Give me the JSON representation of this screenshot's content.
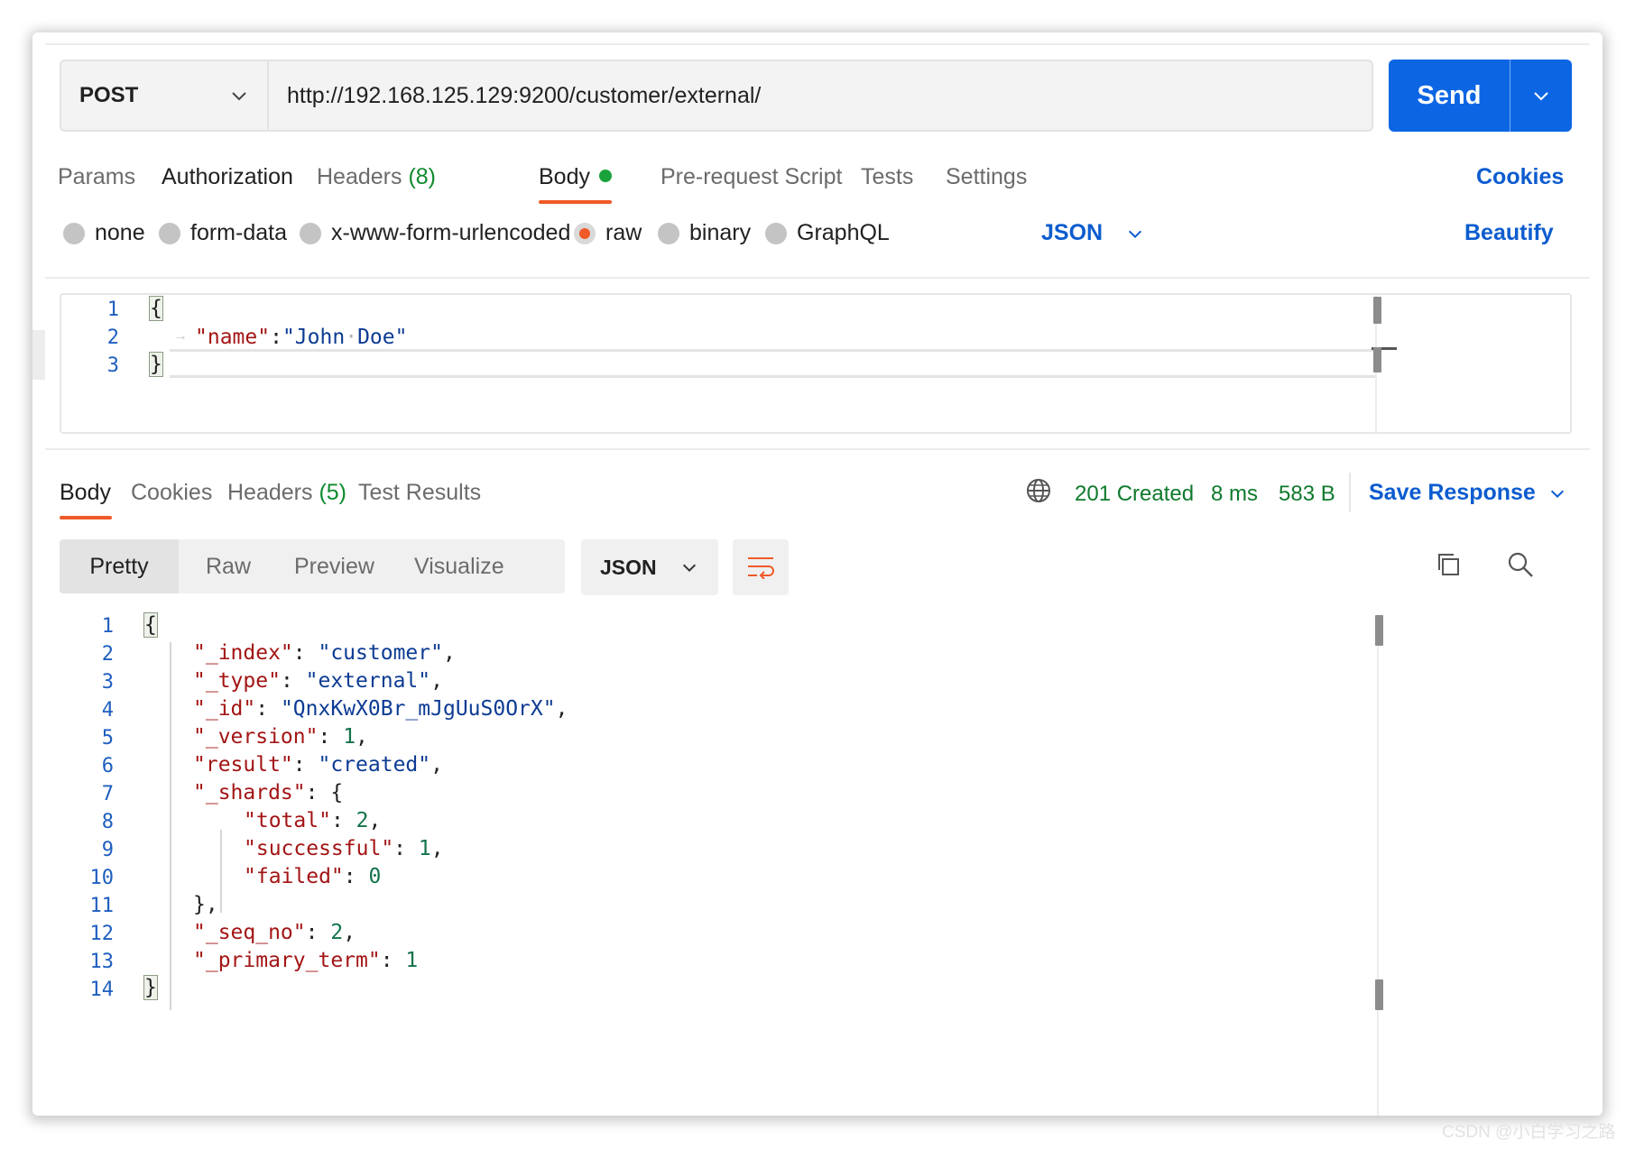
{
  "request": {
    "method": "POST",
    "url": "http://192.168.125.129:9200/customer/external/",
    "send_label": "Send"
  },
  "request_tabs": {
    "params": "Params",
    "authorization": "Authorization",
    "headers": "Headers",
    "headers_count": "(8)",
    "body": "Body",
    "pre_request": "Pre-request Script",
    "tests": "Tests",
    "settings": "Settings",
    "active": "Body"
  },
  "cookies_label": "Cookies",
  "body_types": {
    "options": [
      "none",
      "form-data",
      "x-www-form-urlencoded",
      "raw",
      "binary",
      "GraphQL"
    ],
    "selected": "raw",
    "language": "JSON",
    "beautify_label": "Beautify"
  },
  "request_body": {
    "line_numbers": [
      "1",
      "2",
      "3"
    ],
    "open_brace": "{",
    "key": "\"name\"",
    "colon": ":",
    "value_part1": "\"John",
    "ws_dot": "·",
    "value_part2": "Doe\"",
    "close_brace": "}"
  },
  "response": {
    "tabs": {
      "body": "Body",
      "cookies": "Cookies",
      "headers": "Headers",
      "headers_count": "(5)",
      "test_results": "Test Results",
      "active": "Body"
    },
    "status": "201 Created",
    "time": "8 ms",
    "size": "583 B",
    "save_label": "Save Response",
    "views": [
      "Pretty",
      "Raw",
      "Preview",
      "Visualize"
    ],
    "active_view": "Pretty",
    "format": "JSON",
    "line_numbers": [
      "1",
      "2",
      "3",
      "4",
      "5",
      "6",
      "7",
      "8",
      "9",
      "10",
      "11",
      "12",
      "13",
      "14"
    ],
    "lines": {
      "l1": "{",
      "l2_key": "\"_index\"",
      "l2_val": "\"customer\"",
      "l3_key": "\"_type\"",
      "l3_val": "\"external\"",
      "l4_key": "\"_id\"",
      "l4_val": "\"QnxKwX0Br_mJgUuS0OrX\"",
      "l5_key": "\"_version\"",
      "l5_val": "1",
      "l6_key": "\"result\"",
      "l6_val": "\"created\"",
      "l7_key": "\"_shards\"",
      "l7_brace": "{",
      "l8_key": "\"total\"",
      "l8_val": "2",
      "l9_key": "\"successful\"",
      "l9_val": "1",
      "l10_key": "\"failed\"",
      "l10_val": "0",
      "l11": "},",
      "l12_key": "\"_seq_no\"",
      "l12_val": "2",
      "l13_key": "\"_primary_term\"",
      "l13_val": "1",
      "l14": "}"
    }
  },
  "watermark": "CSDN @小白学习之路",
  "colors": {
    "accent_blue": "#0c66e4",
    "link_blue": "#0c5ccf",
    "tab_orange": "#f05a28",
    "status_green": "#0f7a2c"
  },
  "icons": [
    "chevron-down-icon",
    "globe-icon",
    "wrap-lines-icon",
    "copy-icon",
    "search-icon"
  ]
}
